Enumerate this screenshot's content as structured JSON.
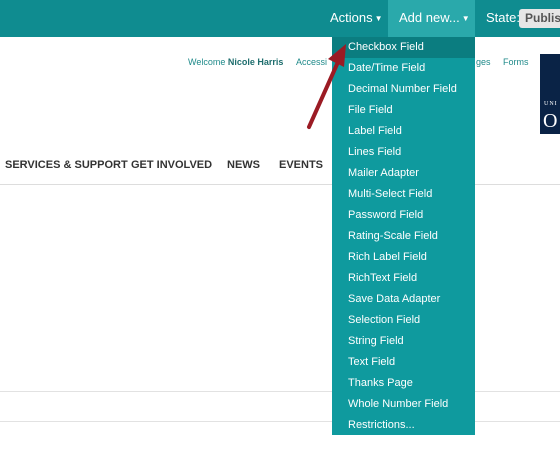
{
  "toolbar": {
    "actions_label": "Actions",
    "add_new_label": "Add new...",
    "state_label": "State:",
    "state_value": "Publis"
  },
  "header": {
    "welcome_prefix": "Welcome",
    "user_name": "Nicole Harris",
    "accessibility_link": "Accessi",
    "partial_link": "ges",
    "forms_link": "Forms",
    "logo_small": "UNI",
    "logo_big": "O"
  },
  "nav": {
    "items": [
      {
        "label": "SERVICES & SUPPORT"
      },
      {
        "label": "GET INVOLVED"
      },
      {
        "label": "NEWS"
      },
      {
        "label": "EVENTS"
      }
    ]
  },
  "dropdown": {
    "items": [
      {
        "label": "Checkbox Field",
        "active": true
      },
      {
        "label": "Date/Time Field"
      },
      {
        "label": "Decimal Number Field"
      },
      {
        "label": "File Field"
      },
      {
        "label": "Label Field"
      },
      {
        "label": "Lines Field"
      },
      {
        "label": "Mailer Adapter"
      },
      {
        "label": "Multi-Select Field"
      },
      {
        "label": "Password Field"
      },
      {
        "label": "Rating-Scale Field"
      },
      {
        "label": "Rich Label Field"
      },
      {
        "label": "RichText Field"
      },
      {
        "label": "Save Data Adapter"
      },
      {
        "label": "Selection Field"
      },
      {
        "label": "String Field"
      },
      {
        "label": "Text Field"
      },
      {
        "label": "Thanks Page"
      },
      {
        "label": "Whole Number Field"
      },
      {
        "label": "Restrictions..."
      }
    ]
  },
  "colors": {
    "toolbar": "#0f8c90",
    "add_new_active": "#2aa9ab",
    "dropdown": "#0f9a9e",
    "dropdown_active": "#0b7d80",
    "arrow": "#9b1b24"
  }
}
